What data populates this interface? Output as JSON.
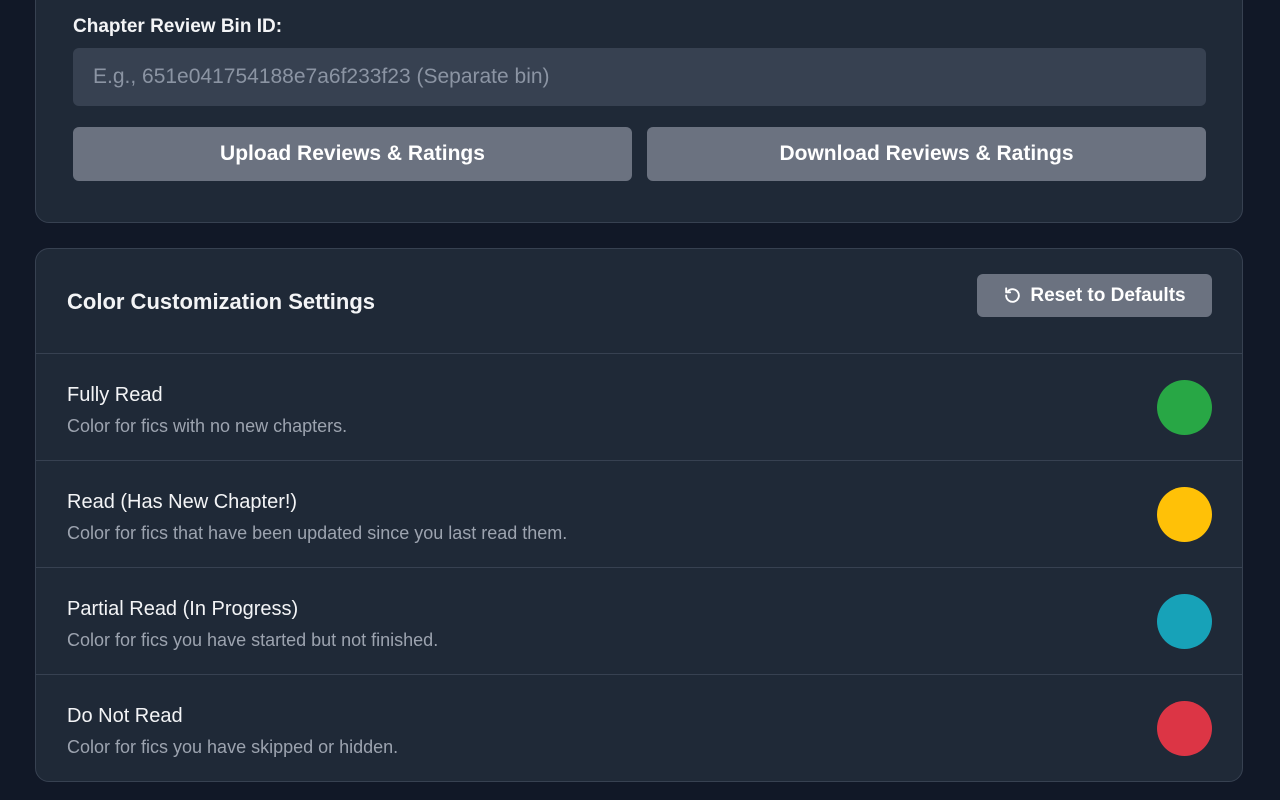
{
  "sync": {
    "chapter_bin_label": "Chapter Review Bin ID:",
    "chapter_bin_placeholder": "E.g., 651e041754188e7a6f233f23 (Separate bin)",
    "upload_label": "Upload Reviews & Ratings",
    "download_label": "Download Reviews & Ratings"
  },
  "colors_section": {
    "title": "Color Customization Settings",
    "reset_label": "Reset to Defaults",
    "reset_icon": "reset-icon",
    "items": [
      {
        "name": "Fully Read",
        "description": "Color for fics with no new chapters.",
        "color": "#28a745"
      },
      {
        "name": "Read (Has New Chapter!)",
        "description": "Color for fics that have been updated since you last read them.",
        "color": "#ffc107"
      },
      {
        "name": "Partial Read (In Progress)",
        "description": "Color for fics you have started but not finished.",
        "color": "#17a2b8"
      },
      {
        "name": "Do Not Read",
        "description": "Color for fics you have skipped or hidden.",
        "color": "#dc3545"
      }
    ]
  }
}
